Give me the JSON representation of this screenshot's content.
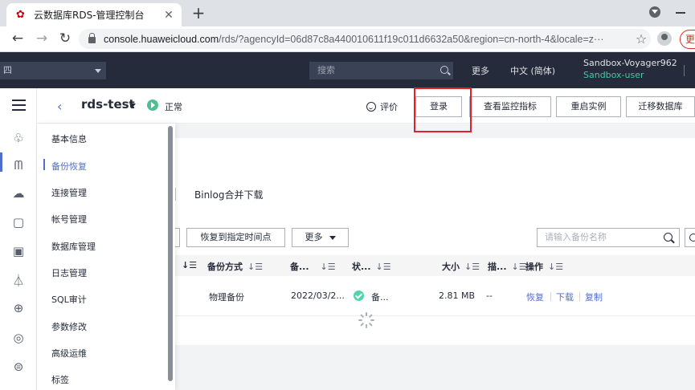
{
  "browser": {
    "tab_title": "云数据库RDS-管理控制台",
    "tab_close": "✕",
    "new_tab": "+",
    "url_host": "console.huaweicloud.com",
    "url_path": "/rds/?agencyId=06d87c8a440010611f19c011d6632a50&region=cn-north-4&locale=z···",
    "star": "☆",
    "update_label": "更"
  },
  "header": {
    "region": "四",
    "search_placeholder": "搜索",
    "more": "更多",
    "language": "中文 (简体)",
    "account": "Sandbox-Voyager962",
    "sub_account": "Sandbox-user"
  },
  "instance": {
    "back": "‹",
    "name": "rds-test",
    "status": "正常",
    "rate": "评价",
    "buttons": [
      "登录",
      "查看监控指标",
      "重启实例",
      "迁移数据库"
    ]
  },
  "side_menu": {
    "items": [
      "基本信息",
      "备份恢复",
      "连接管理",
      "帐号管理",
      "数据库管理",
      "日志管理",
      "SQL审计",
      "参数修改",
      "高级运维",
      "标签"
    ],
    "active_index": 1
  },
  "backup": {
    "tab_binlog": "Binlog合并下载",
    "restore_point_button": "恢复到指定时间点",
    "more_button": "更多",
    "search_placeholder": "请输入备份名称",
    "columns": [
      "备份方式",
      "备...",
      "状...",
      "大小",
      "描...",
      "操作"
    ],
    "filter_glyph": "↓☰",
    "row": {
      "method": "物理备份",
      "time": "2022/03/2...",
      "status": "备...",
      "size": "2.81 MB",
      "desc": "--",
      "actions": [
        "恢复",
        "下载",
        "复制"
      ]
    }
  },
  "colors": {
    "header_bg": "#252b3a",
    "accent": "#526ecc",
    "success": "#50d4ab",
    "highlight": "#e0202a"
  }
}
